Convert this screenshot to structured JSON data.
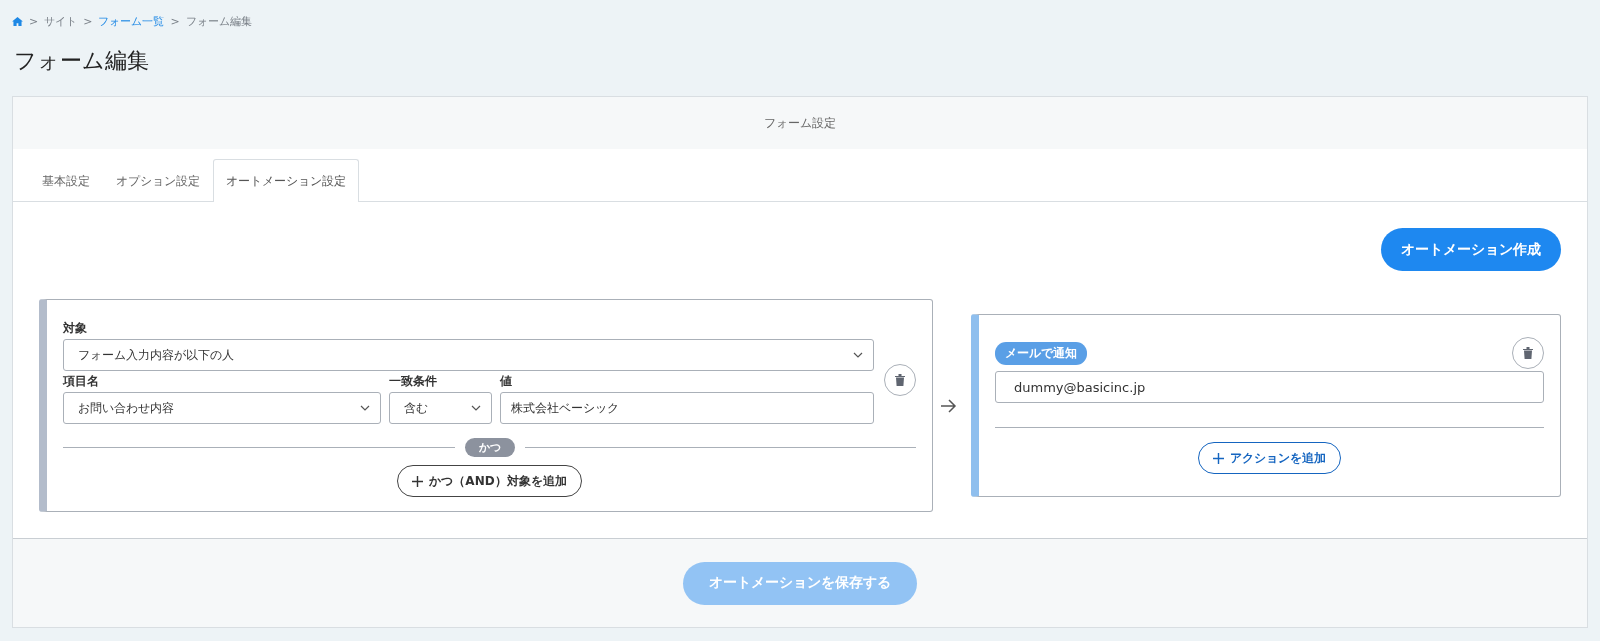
{
  "breadcrumb": {
    "separator": ">",
    "items": [
      {
        "label": "サイト",
        "kind": "text"
      },
      {
        "label": "フォーム一覧",
        "kind": "link"
      },
      {
        "label": "フォーム編集",
        "kind": "text"
      }
    ]
  },
  "page_title": "フォーム編集",
  "card": {
    "header": "フォーム設定",
    "tabs": [
      {
        "label": "基本設定",
        "selected": false
      },
      {
        "label": "オプション設定",
        "selected": false
      },
      {
        "label": "オートメーション設定",
        "selected": true
      }
    ],
    "create_button": "オートメーション作成",
    "condition": {
      "target_label": "対象",
      "target_value": "フォーム入力内容が以下の人",
      "field_label": "項目名",
      "field_value": "お問い合わせ内容",
      "match_label": "一致条件",
      "match_value": "含む",
      "value_label": "値",
      "value": "株式会社ベーシック",
      "joiner": "かつ",
      "add_button": "かつ（AND）対象を追加"
    },
    "action": {
      "tag": "メールで通知",
      "email": "dummy@basicinc.jp",
      "add_button": "アクションを追加"
    },
    "save_button": {
      "label": "オートメーションを保存する",
      "disabled": true
    }
  }
}
